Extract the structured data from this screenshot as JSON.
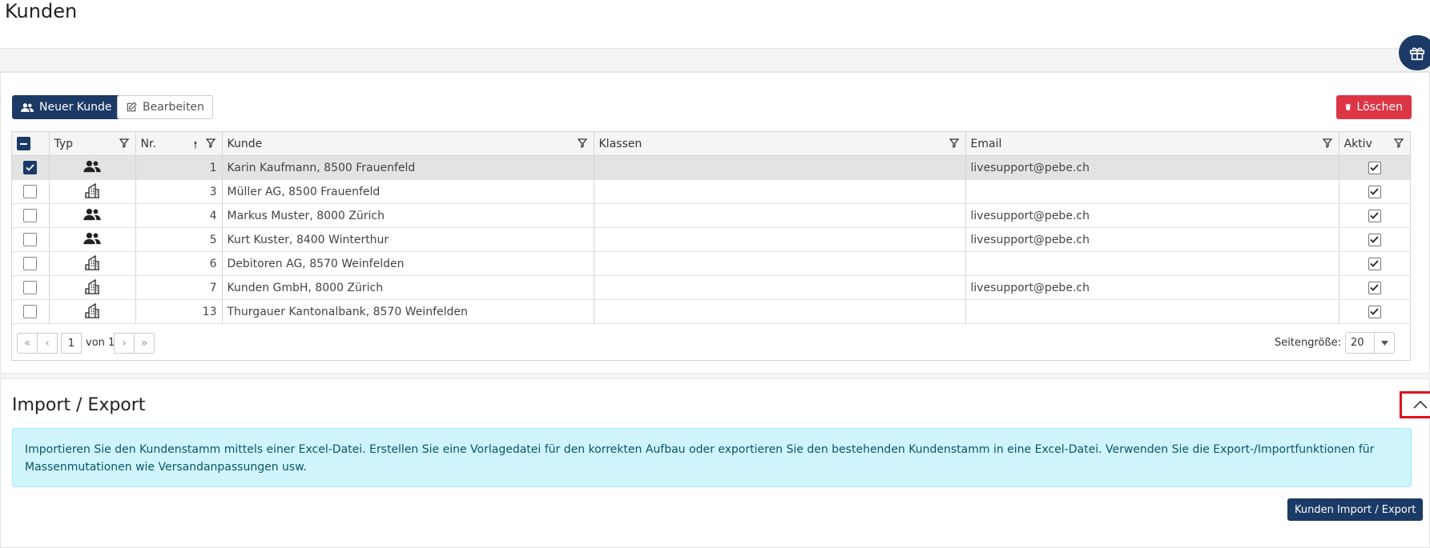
{
  "page": {
    "title": "Kunden"
  },
  "toolbar": {
    "new_label": "Neuer Kunde",
    "edit_label": "Bearbeiten",
    "delete_label": "Löschen"
  },
  "table": {
    "headers": {
      "typ": "Typ",
      "nr": "Nr.",
      "kunde": "Kunde",
      "klassen": "Klassen",
      "email": "Email",
      "aktiv": "Aktiv"
    },
    "rows": [
      {
        "selected": true,
        "type": "person",
        "nr": "1",
        "kunde": "Karin Kaufmann, 8500 Frauenfeld",
        "klassen": "",
        "email": "livesupport@pebe.ch",
        "aktiv": true
      },
      {
        "selected": false,
        "type": "building",
        "nr": "3",
        "kunde": "Müller AG, 8500 Frauenfeld",
        "klassen": "",
        "email": "",
        "aktiv": true
      },
      {
        "selected": false,
        "type": "person",
        "nr": "4",
        "kunde": "Markus Muster, 8000 Zürich",
        "klassen": "",
        "email": "livesupport@pebe.ch",
        "aktiv": true
      },
      {
        "selected": false,
        "type": "person",
        "nr": "5",
        "kunde": "Kurt Kuster, 8400 Winterthur",
        "klassen": "",
        "email": "livesupport@pebe.ch",
        "aktiv": true
      },
      {
        "selected": false,
        "type": "building",
        "nr": "6",
        "kunde": "Debitoren AG, 8570 Weinfelden",
        "klassen": "",
        "email": "",
        "aktiv": true
      },
      {
        "selected": false,
        "type": "building",
        "nr": "7",
        "kunde": "Kunden GmbH, 8000 Zürich",
        "klassen": "",
        "email": "livesupport@pebe.ch",
        "aktiv": true
      },
      {
        "selected": false,
        "type": "building",
        "nr": "13",
        "kunde": "Thurgauer Kantonalbank, 8570 Weinfelden",
        "klassen": "",
        "email": "",
        "aktiv": true
      }
    ]
  },
  "pager": {
    "page": "1",
    "of_label": "von 1",
    "page_size_label": "Seitengröße:",
    "page_size": "20"
  },
  "import_export": {
    "title": "Import / Export",
    "info": "Importieren Sie den Kundenstamm mittels einer Excel-Datei. Erstellen Sie eine Vorlagedatei für den korrekten Aufbau oder exportieren Sie den bestehenden Kundenstamm in eine Excel-Datei. Verwenden Sie die Export-/Importfunktionen für Massenmutationen wie Versandanpassungen usw.",
    "button_label": "Kunden Import / Export"
  },
  "colors": {
    "primary": "#1b3a66",
    "danger": "#dc3545",
    "info_bg": "#cff4fc",
    "highlight": "#e0131b"
  }
}
